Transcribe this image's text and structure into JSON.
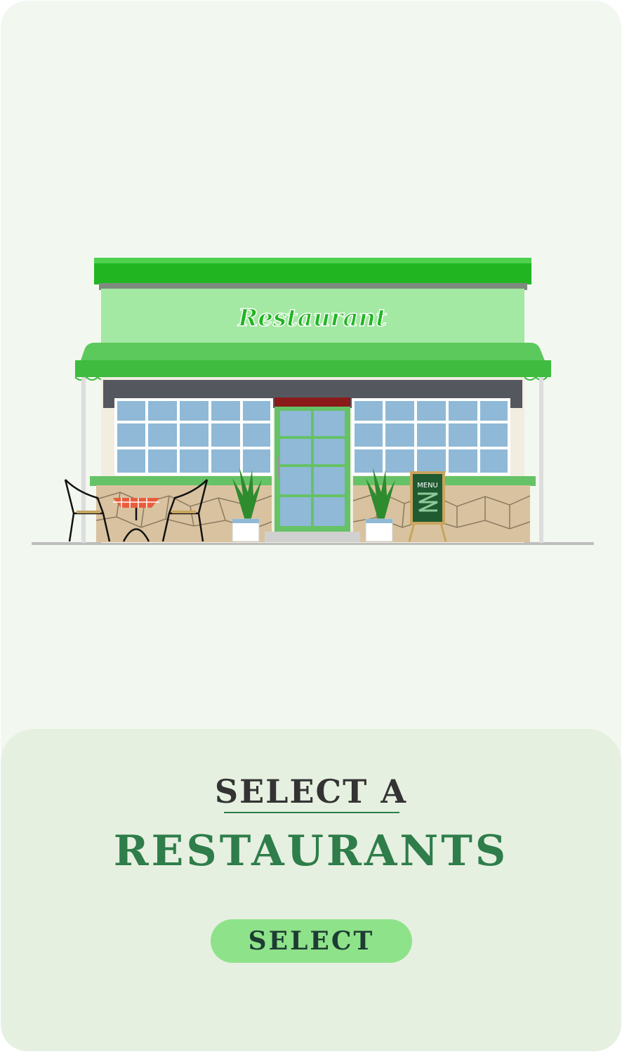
{
  "illustration": {
    "sign_text": "Restaurant",
    "menu_board_text": "MENU"
  },
  "panel": {
    "heading_line1": "SELECT A",
    "heading_line2": "RESTAURANTS",
    "select_label": "SELECT"
  },
  "colors": {
    "card_bg": "#f2f7f0",
    "panel_bg": "#e6f0e0",
    "heading_green": "#2e7d4a",
    "button_bg": "#8ee28a",
    "roof_green": "#22b522",
    "wall_green": "#a3e8a3"
  }
}
